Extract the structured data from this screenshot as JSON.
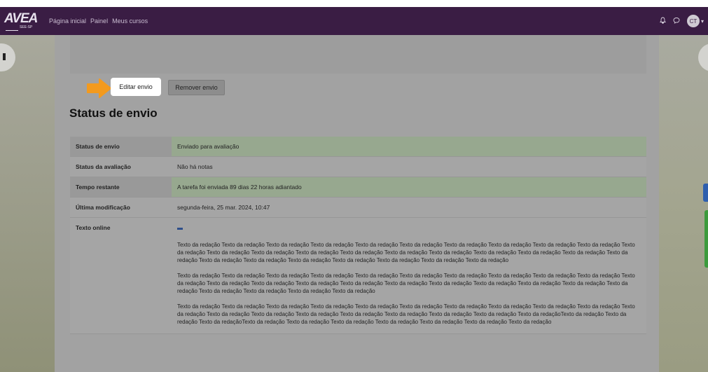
{
  "navbar": {
    "logo_text": "AVEA",
    "logo_subtext": "SEE-SP",
    "links": [
      "Página inicial",
      "Painel",
      "Meus cursos"
    ],
    "avatar_initials": "CT"
  },
  "actions": {
    "edit_label": "Editar envio",
    "remove_label": "Remover envio"
  },
  "section_title": "Status de envio",
  "status_rows": [
    {
      "label": "Status de envio",
      "value": "Enviado para avaliação"
    },
    {
      "label": "Status da avaliação",
      "value": "Não há notas"
    },
    {
      "label": "Tempo restante",
      "value": "A tarefa foi enviada 89 dias 22 horas adiantado"
    },
    {
      "label": "Última modificação",
      "value": "segunda-feira, 25 mar. 2024, 10:47"
    }
  ],
  "online_text": {
    "label": "Texto online",
    "paragraphs": [
      "Texto da redação Texto da redação Texto da redação Texto da redação Texto da redação Texto da redação Texto da redação Texto da redação Texto da redação Texto da redação Texto da redação Texto da redação Texto da redação Texto da redação Texto da redação Texto da redação Texto da redação Texto da redação Texto da redação Texto da redação Texto da redação Texto da redação Texto da redação Texto da redação Texto da redação Texto da redação Texto da redação Texto da redação",
      "Texto da redação Texto da redação Texto da redação Texto da redação Texto da redação Texto da redação Texto da redação Texto da redação Texto da redação Texto da redação Texto da redação Texto da redação Texto da redação Texto da redação Texto da redação Texto da redação Texto da redação Texto da redação Texto da redação Texto da redação Texto da redação Texto da redação Texto da redação Texto da redação Texto da redação",
      "Texto da redação Texto da redação Texto da redação Texto da redação Texto da redação Texto da redação Texto da redação Texto da redação Texto da redação Texto da redação Texto da redação Texto da redação Texto da redação Texto da redação Texto da redação Texto da redação Texto da redação Texto da redação Texto da redaçãoTexto da redação Texto da redação Texto da redaçãoTexto da redação Texto da redação Texto da redação Texto da redação Texto da redação Texto da redação Texto da redação"
    ]
  },
  "colors": {
    "navbar": "#3a1d44",
    "highlight_arrow": "#f39a1e",
    "success_row": "#97a88f"
  },
  "icons": [
    "bell-icon",
    "chat-icon",
    "chevron-down-icon",
    "arrow-icon"
  ]
}
